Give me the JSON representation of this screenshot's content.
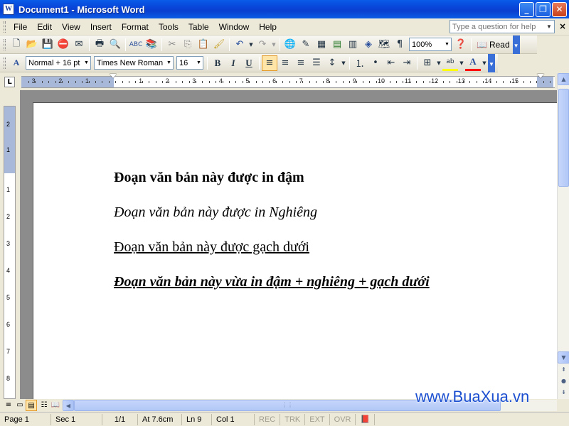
{
  "window": {
    "title": "Document1 - Microsoft Word",
    "app_icon": "W"
  },
  "menu": {
    "items": [
      "File",
      "Edit",
      "View",
      "Insert",
      "Format",
      "Tools",
      "Table",
      "Window",
      "Help"
    ],
    "help_placeholder": "Type a question for help"
  },
  "standard_toolbar": {
    "zoom": "100%",
    "read_label": "Read"
  },
  "format_toolbar": {
    "style": "Normal + 16 pt",
    "font": "Times New Roman",
    "size": "16",
    "bold_label": "B",
    "italic_label": "I",
    "underline_label": "U"
  },
  "ruler": {
    "tab_selector": "L",
    "h_numbers": [
      "3",
      "2",
      "1",
      "1",
      "2",
      "3",
      "4",
      "5",
      "6",
      "7",
      "8",
      "9",
      "10",
      "11",
      "12",
      "13",
      "14",
      "15"
    ],
    "v_numbers": [
      "2",
      "1",
      "1",
      "2",
      "3",
      "4",
      "5",
      "6",
      "7",
      "8"
    ]
  },
  "document": {
    "bold": "Đoạn văn bản này được in đậm",
    "italic": "Đoạn văn bản này được in Nghiêng",
    "underline": "Đoạn văn bản này được gạch dưới",
    "all": "Đoạn văn bản này vừa in đậm + nghiêng + gạch dưới"
  },
  "watermark": "www.BuaXua.vn",
  "status": {
    "page": "Page 1",
    "sec": "Sec 1",
    "count": "1/1",
    "at": "At 7.6cm",
    "ln": "Ln 9",
    "col": "Col 1",
    "rec": "REC",
    "trk": "TRK",
    "ext": "EXT",
    "ovr": "OVR"
  },
  "colors": {
    "titlebar": "#0a5ce8",
    "accent": "#1b4fd0",
    "highlight": "#ffff00",
    "font_color": "#ff0000"
  }
}
